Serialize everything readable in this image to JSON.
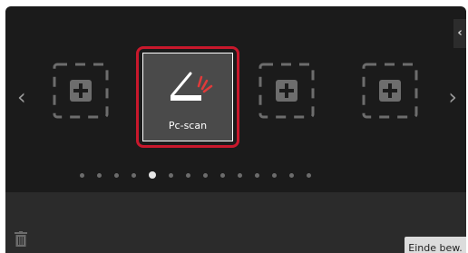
{
  "home": {
    "selected_app": {
      "label": "Pc-scan",
      "icon": "scanner-icon"
    },
    "empty_slot_icon": "add-icon",
    "page_count": 14,
    "active_page": 5
  },
  "footer": {
    "delete_icon": "trash-icon",
    "done_label": "Einde bew."
  },
  "colors": {
    "selection_border": "#c8182c",
    "scan_accent": "#e03a3a",
    "background": "#1b1b1b"
  }
}
